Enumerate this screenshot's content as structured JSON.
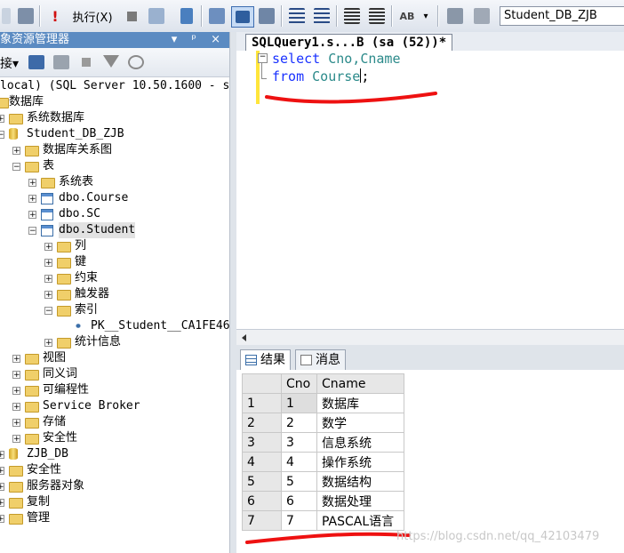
{
  "toolbar": {
    "execute_label": "执行(X)",
    "database_selected": "Student_DB_ZJB"
  },
  "object_explorer": {
    "title": "象资源管理器",
    "title_buttons": "▾ ᵖ ×",
    "connect_label": "接▾",
    "tree": [
      {
        "text": "local) (SQL Server 10.50.1600 - s",
        "icon": "server-icon"
      },
      {
        "text": "数据库",
        "icon": "folder-icon"
      },
      {
        "text": "系统数据库",
        "icon": "folder-icon"
      },
      {
        "text": "Student_DB_ZJB",
        "icon": "database-icon"
      },
      {
        "text": "数据库关系图",
        "icon": "folder-icon"
      },
      {
        "text": "表",
        "icon": "folder-icon"
      },
      {
        "text": "系统表",
        "icon": "folder-icon"
      },
      {
        "text": "dbo.Course",
        "icon": "table-icon"
      },
      {
        "text": "dbo.SC",
        "icon": "table-icon"
      },
      {
        "text": "dbo.Student",
        "icon": "table-icon"
      },
      {
        "text": "列",
        "icon": "folder-icon"
      },
      {
        "text": "键",
        "icon": "folder-icon"
      },
      {
        "text": "约束",
        "icon": "folder-icon"
      },
      {
        "text": "触发器",
        "icon": "folder-icon"
      },
      {
        "text": "索引",
        "icon": "folder-icon"
      },
      {
        "text": "PK__Student__CA1FE46",
        "icon": "index-icon"
      },
      {
        "text": "统计信息",
        "icon": "folder-icon"
      },
      {
        "text": "视图",
        "icon": "folder-icon"
      },
      {
        "text": "同义词",
        "icon": "folder-icon"
      },
      {
        "text": "可编程性",
        "icon": "folder-icon"
      },
      {
        "text": "Service Broker",
        "icon": "folder-icon"
      },
      {
        "text": "存储",
        "icon": "folder-icon"
      },
      {
        "text": "安全性",
        "icon": "folder-icon"
      },
      {
        "text": "ZJB_DB",
        "icon": "database-icon"
      },
      {
        "text": "安全性",
        "icon": "folder-icon"
      },
      {
        "text": "服务器对象",
        "icon": "folder-icon"
      },
      {
        "text": "复制",
        "icon": "folder-icon"
      },
      {
        "text": "管理",
        "icon": "folder-icon"
      }
    ]
  },
  "query_tab": {
    "label": "SQLQuery1.s...B (sa (52))*"
  },
  "editor": {
    "line1": {
      "kw": "select",
      "ids": "Cno,Cname"
    },
    "line2": {
      "kw": "from",
      "ids": "Course",
      "end": ";"
    }
  },
  "results": {
    "tab_results": "结果",
    "tab_messages": "消息",
    "columns": [
      "Cno",
      "Cname"
    ],
    "rows": [
      [
        "1",
        "1",
        "数据库"
      ],
      [
        "2",
        "2",
        "数学"
      ],
      [
        "3",
        "3",
        "信息系统"
      ],
      [
        "4",
        "4",
        "操作系统"
      ],
      [
        "5",
        "5",
        "数据结构"
      ],
      [
        "6",
        "6",
        "数据处理"
      ],
      [
        "7",
        "7",
        "PASCAL语言"
      ]
    ]
  },
  "watermark": "https://blog.csdn.net/qq_42103479",
  "colors": {
    "keyword": "#1a32ff",
    "identifier": "#2b8a8a",
    "annotation": "#ee1111"
  }
}
